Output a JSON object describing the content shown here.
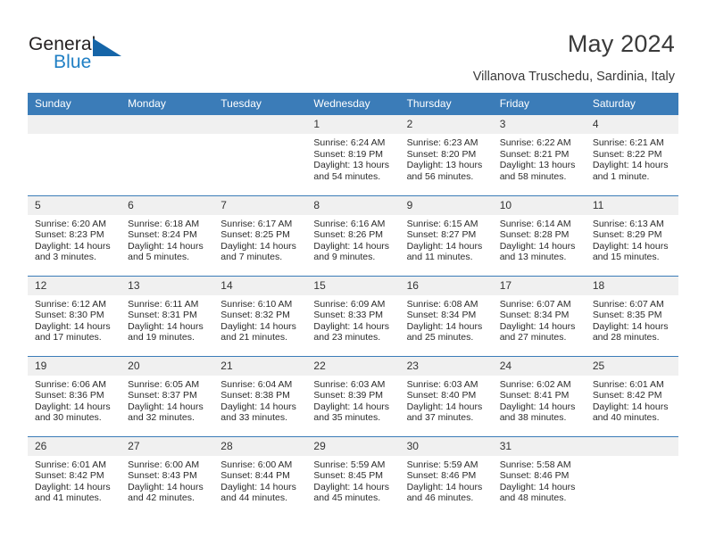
{
  "brand": {
    "name_part1": "General",
    "name_part2": "Blue",
    "triangle_icon": "triangle-icon",
    "accent_color": "#1f7fc4"
  },
  "header": {
    "title": "May 2024",
    "subtitle": "Villanova Truschedu, Sardinia, Italy"
  },
  "calendar": {
    "header_bg": "#3b7cb8",
    "daynum_bg": "#f0f0f0",
    "weekdays": [
      "Sunday",
      "Monday",
      "Tuesday",
      "Wednesday",
      "Thursday",
      "Friday",
      "Saturday"
    ],
    "weeks": [
      [
        {
          "day": "",
          "lines": []
        },
        {
          "day": "",
          "lines": []
        },
        {
          "day": "",
          "lines": []
        },
        {
          "day": "1",
          "lines": [
            "Sunrise: 6:24 AM",
            "Sunset: 8:19 PM",
            "Daylight: 13 hours",
            "and 54 minutes."
          ]
        },
        {
          "day": "2",
          "lines": [
            "Sunrise: 6:23 AM",
            "Sunset: 8:20 PM",
            "Daylight: 13 hours",
            "and 56 minutes."
          ]
        },
        {
          "day": "3",
          "lines": [
            "Sunrise: 6:22 AM",
            "Sunset: 8:21 PM",
            "Daylight: 13 hours",
            "and 58 minutes."
          ]
        },
        {
          "day": "4",
          "lines": [
            "Sunrise: 6:21 AM",
            "Sunset: 8:22 PM",
            "Daylight: 14 hours",
            "and 1 minute."
          ]
        }
      ],
      [
        {
          "day": "5",
          "lines": [
            "Sunrise: 6:20 AM",
            "Sunset: 8:23 PM",
            "Daylight: 14 hours",
            "and 3 minutes."
          ]
        },
        {
          "day": "6",
          "lines": [
            "Sunrise: 6:18 AM",
            "Sunset: 8:24 PM",
            "Daylight: 14 hours",
            "and 5 minutes."
          ]
        },
        {
          "day": "7",
          "lines": [
            "Sunrise: 6:17 AM",
            "Sunset: 8:25 PM",
            "Daylight: 14 hours",
            "and 7 minutes."
          ]
        },
        {
          "day": "8",
          "lines": [
            "Sunrise: 6:16 AM",
            "Sunset: 8:26 PM",
            "Daylight: 14 hours",
            "and 9 minutes."
          ]
        },
        {
          "day": "9",
          "lines": [
            "Sunrise: 6:15 AM",
            "Sunset: 8:27 PM",
            "Daylight: 14 hours",
            "and 11 minutes."
          ]
        },
        {
          "day": "10",
          "lines": [
            "Sunrise: 6:14 AM",
            "Sunset: 8:28 PM",
            "Daylight: 14 hours",
            "and 13 minutes."
          ]
        },
        {
          "day": "11",
          "lines": [
            "Sunrise: 6:13 AM",
            "Sunset: 8:29 PM",
            "Daylight: 14 hours",
            "and 15 minutes."
          ]
        }
      ],
      [
        {
          "day": "12",
          "lines": [
            "Sunrise: 6:12 AM",
            "Sunset: 8:30 PM",
            "Daylight: 14 hours",
            "and 17 minutes."
          ]
        },
        {
          "day": "13",
          "lines": [
            "Sunrise: 6:11 AM",
            "Sunset: 8:31 PM",
            "Daylight: 14 hours",
            "and 19 minutes."
          ]
        },
        {
          "day": "14",
          "lines": [
            "Sunrise: 6:10 AM",
            "Sunset: 8:32 PM",
            "Daylight: 14 hours",
            "and 21 minutes."
          ]
        },
        {
          "day": "15",
          "lines": [
            "Sunrise: 6:09 AM",
            "Sunset: 8:33 PM",
            "Daylight: 14 hours",
            "and 23 minutes."
          ]
        },
        {
          "day": "16",
          "lines": [
            "Sunrise: 6:08 AM",
            "Sunset: 8:34 PM",
            "Daylight: 14 hours",
            "and 25 minutes."
          ]
        },
        {
          "day": "17",
          "lines": [
            "Sunrise: 6:07 AM",
            "Sunset: 8:34 PM",
            "Daylight: 14 hours",
            "and 27 minutes."
          ]
        },
        {
          "day": "18",
          "lines": [
            "Sunrise: 6:07 AM",
            "Sunset: 8:35 PM",
            "Daylight: 14 hours",
            "and 28 minutes."
          ]
        }
      ],
      [
        {
          "day": "19",
          "lines": [
            "Sunrise: 6:06 AM",
            "Sunset: 8:36 PM",
            "Daylight: 14 hours",
            "and 30 minutes."
          ]
        },
        {
          "day": "20",
          "lines": [
            "Sunrise: 6:05 AM",
            "Sunset: 8:37 PM",
            "Daylight: 14 hours",
            "and 32 minutes."
          ]
        },
        {
          "day": "21",
          "lines": [
            "Sunrise: 6:04 AM",
            "Sunset: 8:38 PM",
            "Daylight: 14 hours",
            "and 33 minutes."
          ]
        },
        {
          "day": "22",
          "lines": [
            "Sunrise: 6:03 AM",
            "Sunset: 8:39 PM",
            "Daylight: 14 hours",
            "and 35 minutes."
          ]
        },
        {
          "day": "23",
          "lines": [
            "Sunrise: 6:03 AM",
            "Sunset: 8:40 PM",
            "Daylight: 14 hours",
            "and 37 minutes."
          ]
        },
        {
          "day": "24",
          "lines": [
            "Sunrise: 6:02 AM",
            "Sunset: 8:41 PM",
            "Daylight: 14 hours",
            "and 38 minutes."
          ]
        },
        {
          "day": "25",
          "lines": [
            "Sunrise: 6:01 AM",
            "Sunset: 8:42 PM",
            "Daylight: 14 hours",
            "and 40 minutes."
          ]
        }
      ],
      [
        {
          "day": "26",
          "lines": [
            "Sunrise: 6:01 AM",
            "Sunset: 8:42 PM",
            "Daylight: 14 hours",
            "and 41 minutes."
          ]
        },
        {
          "day": "27",
          "lines": [
            "Sunrise: 6:00 AM",
            "Sunset: 8:43 PM",
            "Daylight: 14 hours",
            "and 42 minutes."
          ]
        },
        {
          "day": "28",
          "lines": [
            "Sunrise: 6:00 AM",
            "Sunset: 8:44 PM",
            "Daylight: 14 hours",
            "and 44 minutes."
          ]
        },
        {
          "day": "29",
          "lines": [
            "Sunrise: 5:59 AM",
            "Sunset: 8:45 PM",
            "Daylight: 14 hours",
            "and 45 minutes."
          ]
        },
        {
          "day": "30",
          "lines": [
            "Sunrise: 5:59 AM",
            "Sunset: 8:46 PM",
            "Daylight: 14 hours",
            "and 46 minutes."
          ]
        },
        {
          "day": "31",
          "lines": [
            "Sunrise: 5:58 AM",
            "Sunset: 8:46 PM",
            "Daylight: 14 hours",
            "and 48 minutes."
          ]
        },
        {
          "day": "",
          "lines": []
        }
      ]
    ]
  }
}
